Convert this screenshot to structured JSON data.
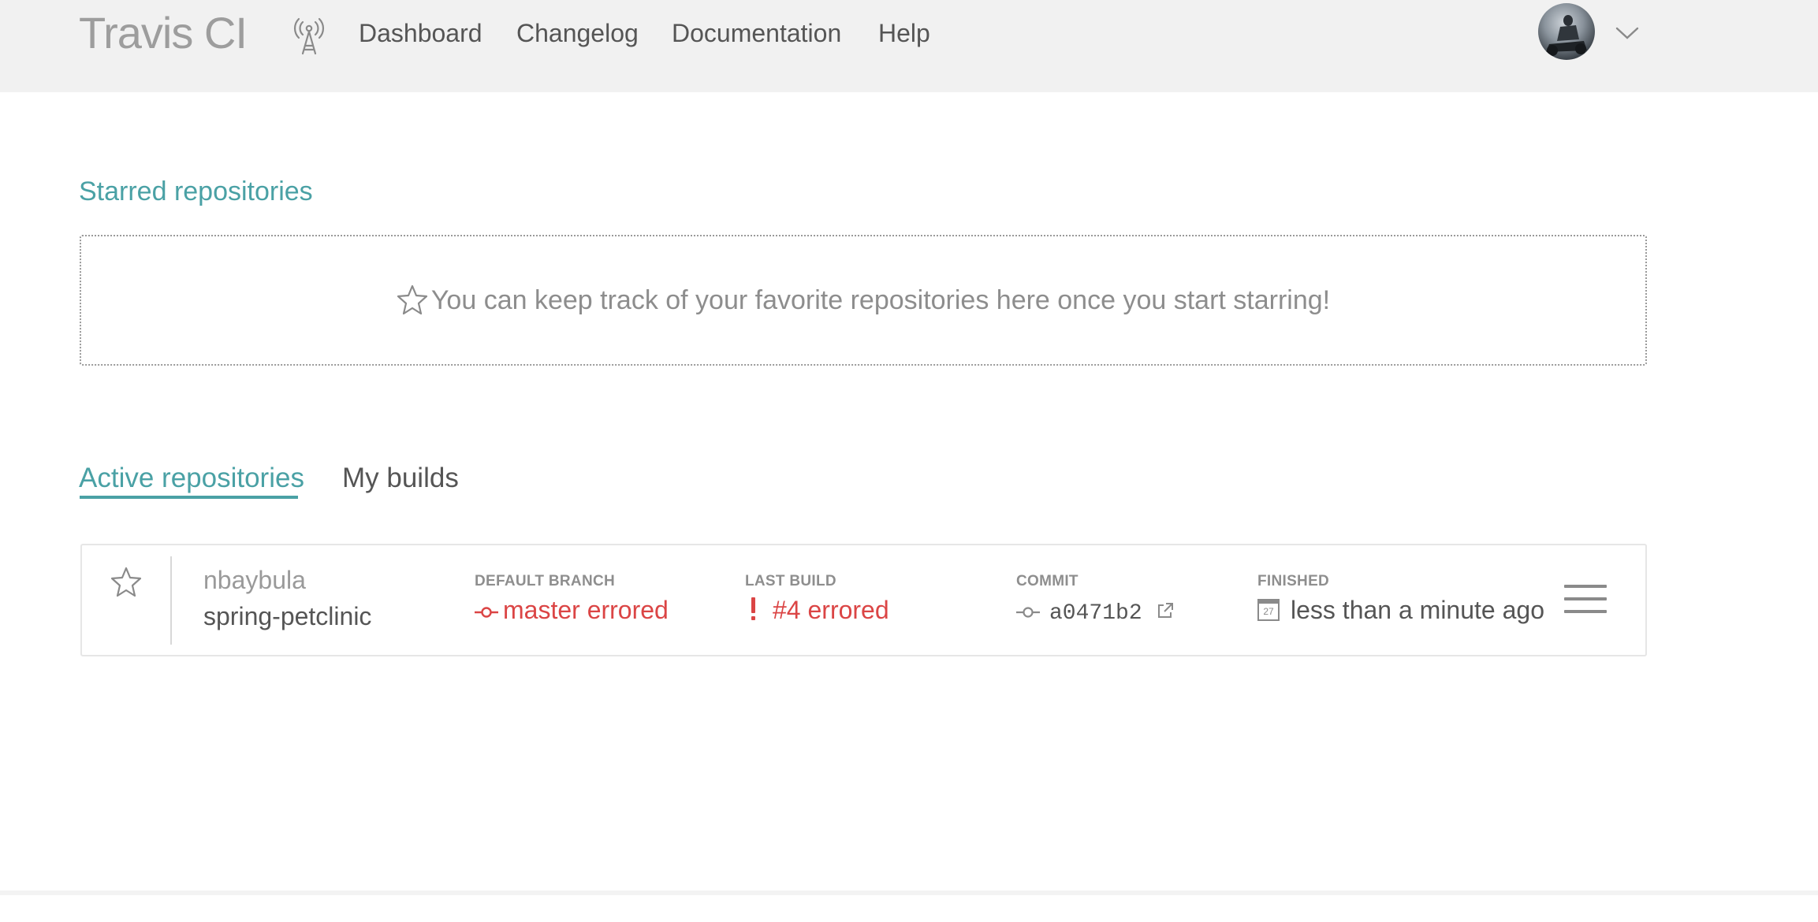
{
  "header": {
    "logo": "Travis CI",
    "nav": [
      "Dashboard",
      "Changelog",
      "Documentation",
      "Help"
    ]
  },
  "starred": {
    "title": "Starred repositories",
    "empty_message": "You can keep track of your favorite repositories here once you start starring!"
  },
  "tabs": {
    "active": "Active repositories",
    "my_builds": "My builds"
  },
  "repo": {
    "owner": "nbaybula",
    "name": "spring-petclinic",
    "default_branch_label": "DEFAULT BRANCH",
    "default_branch_value": "master errored",
    "last_build_label": "LAST BUILD",
    "last_build_value": "#4 errored",
    "commit_label": "COMMIT",
    "commit_value": "a0471b2",
    "finished_label": "FINISHED",
    "finished_value": "less than a minute ago",
    "calendar_day": "27"
  },
  "colors": {
    "accent": "#4aa1a5",
    "error": "#db4545",
    "header_bg": "#f1f1f1"
  }
}
